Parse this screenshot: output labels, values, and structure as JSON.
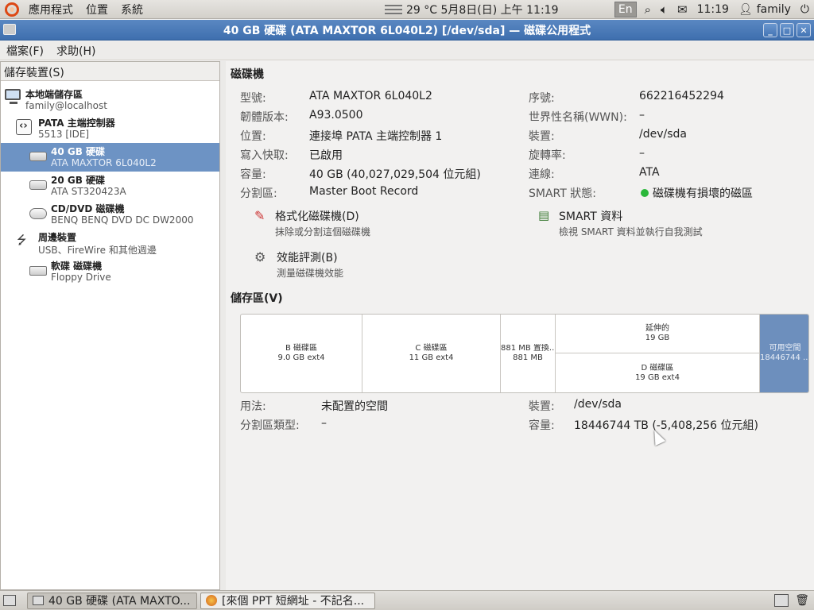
{
  "top_panel": {
    "menus": [
      "應用程式",
      "位置",
      "系統"
    ],
    "weather": "29 °C 5月8日(日) 上午 11:19",
    "input_method": "En",
    "clock": "11:19",
    "user": "family"
  },
  "window": {
    "title": "40 GB 硬碟 (ATA MAXTOR 6L040L2) [/dev/sda] — 磁碟公用程式",
    "menubar": [
      "檔案(F)",
      "求助(H)"
    ]
  },
  "sidebar": {
    "header": "儲存裝置(S)",
    "items": [
      {
        "name": "本地端儲存區",
        "sub": "family@localhost",
        "icon": "computer-icon"
      },
      {
        "name": "PATA 主端控制器",
        "sub": "5513 [IDE]",
        "icon": "controller-icon"
      },
      {
        "name": "40 GB 硬碟",
        "sub": "ATA MAXTOR 6L040L2",
        "icon": "hard-disk-icon",
        "selected": true
      },
      {
        "name": "20 GB 硬碟",
        "sub": "ATA ST320423A",
        "icon": "hard-disk-icon"
      },
      {
        "name": "CD/DVD 磁碟機",
        "sub": "BENQ BENQ    DVD DC DW2000",
        "icon": "optical-drive-icon"
      },
      {
        "name": "周邊裝置",
        "sub": "USB、FireWire 和其他週邊",
        "icon": "usb-icon"
      },
      {
        "name": "軟碟 磁碟機",
        "sub": "Floppy Drive",
        "icon": "floppy-icon"
      }
    ]
  },
  "drive": {
    "section_title": "磁碟機",
    "left": [
      {
        "label": "型號:",
        "value": "ATA MAXTOR 6L040L2"
      },
      {
        "label": "韌體版本:",
        "value": "A93.0500"
      },
      {
        "label": "位置:",
        "value": "連接埠 PATA 主端控制器 1"
      },
      {
        "label": "寫入快取:",
        "value": "已啟用"
      },
      {
        "label": "容量:",
        "value": "40 GB (40,027,029,504 位元組)"
      },
      {
        "label": "分割區:",
        "value": "Master Boot Record"
      }
    ],
    "right": [
      {
        "label": "序號:",
        "value": "662216452294"
      },
      {
        "label": "世界性名稱(WWN):",
        "value": "–"
      },
      {
        "label": "裝置:",
        "value": "/dev/sda"
      },
      {
        "label": "旋轉率:",
        "value": "–"
      },
      {
        "label": "連線:",
        "value": "ATA"
      },
      {
        "label": "SMART 狀態:",
        "value": "磁碟機有損壞的磁區"
      }
    ],
    "actions": {
      "format": {
        "title": "格式化磁碟機(D)",
        "desc": "抹除或分割這個磁碟機"
      },
      "smart": {
        "title": "SMART 資料",
        "desc": "檢視 SMART 資料並執行自我測試"
      },
      "benchmark": {
        "title": "效能評測(B)",
        "desc": "測量磁碟機效能"
      }
    },
    "smart_status_color": "#2bb73a"
  },
  "volumes": {
    "section_title": "儲存區(V)",
    "partitions": [
      {
        "name": "B 磁碟區",
        "detail": "9.0 GB ext4"
      },
      {
        "name": "C 磁碟區",
        "detail": "11 GB ext4"
      },
      {
        "name": "881 MB 置換...",
        "detail": "881 MB"
      },
      {
        "name": "延伸的",
        "detail": "19 GB"
      },
      {
        "name": "D 磁碟區",
        "detail": "19 GB ext4"
      },
      {
        "name": "可用空間",
        "detail": "18446744 ..."
      }
    ],
    "selected_color": "#6d8fbd",
    "details_left": [
      {
        "label": "用法:",
        "value": "未配置的空間"
      },
      {
        "label": "分割區類型:",
        "value": "–"
      }
    ],
    "details_right": [
      {
        "label": "裝置:",
        "value": "/dev/sda"
      },
      {
        "label": "容量:",
        "value": "18446744 TB (-5,408,256 位元組)"
      }
    ]
  },
  "taskbar": {
    "tasks": [
      {
        "label": "40 GB 硬碟 (ATA MAXTO...",
        "active": true
      },
      {
        "label": "[來個 PPT 短網址 - 不記名...",
        "active": false
      }
    ]
  }
}
